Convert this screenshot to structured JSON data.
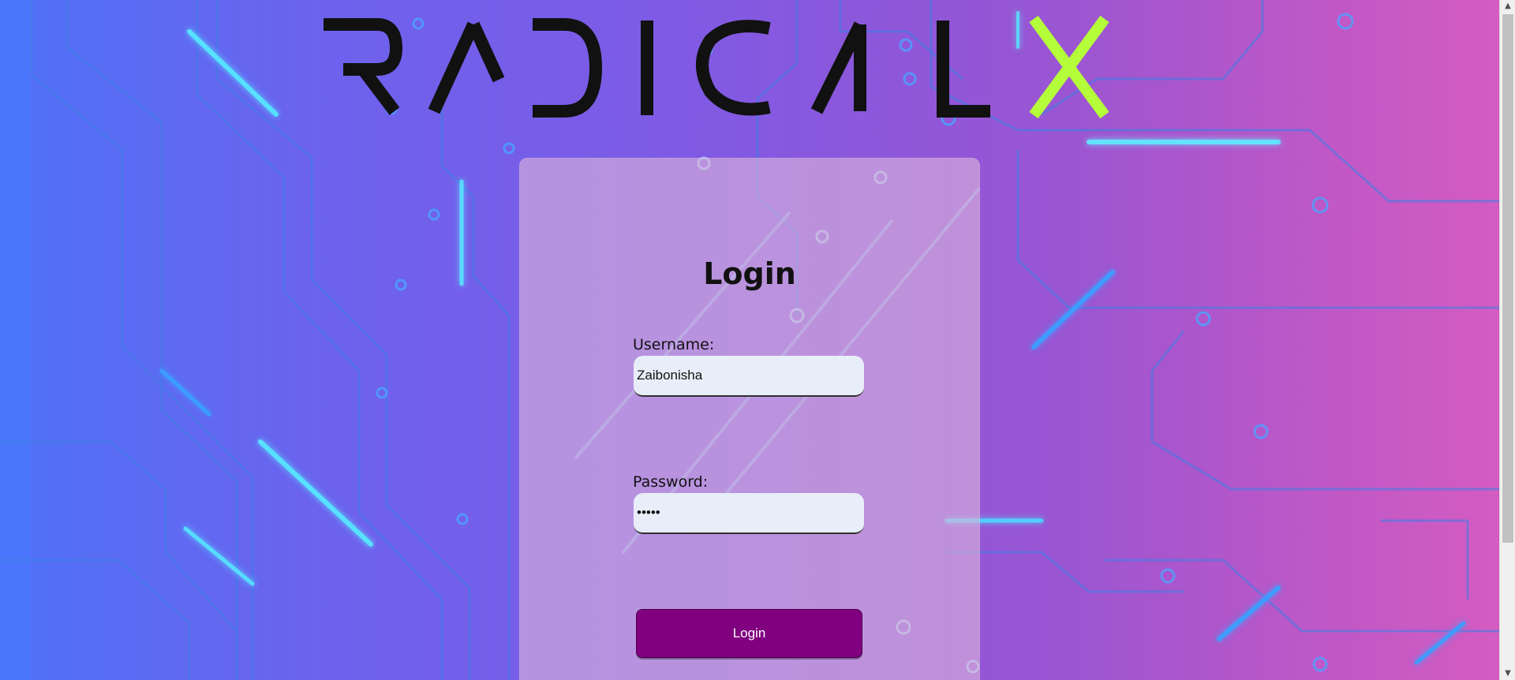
{
  "brand": {
    "logo_text": "RADICAL X",
    "logo_primary_color": "#111111",
    "logo_accent_color": "#b4ff3a"
  },
  "login": {
    "title": "Login",
    "username_label": "Username:",
    "username_value": "Zaibonisha",
    "password_label": "Password:",
    "password_value": "•••••",
    "button_label": "Login"
  },
  "theme": {
    "accent": "#800080",
    "card_tint": "#dcb4dc",
    "background_left": "#4f73f8",
    "background_right": "#d65cc1"
  },
  "scrollbar": {
    "up_icon": "▲",
    "down_icon": "▼"
  }
}
